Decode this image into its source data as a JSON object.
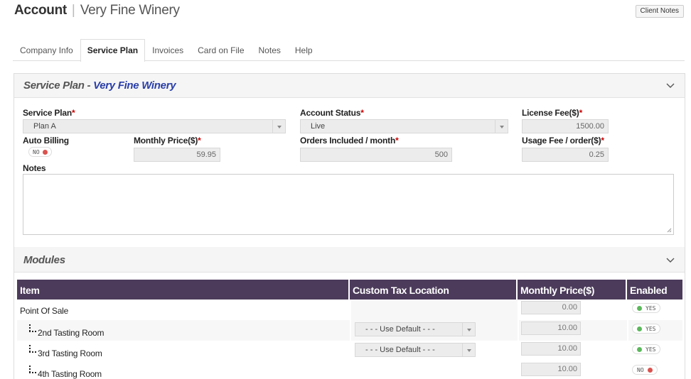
{
  "header": {
    "title": "Account",
    "subtitle": "Very Fine Winery",
    "client_notes_label": "Client Notes"
  },
  "tabs": [
    {
      "label": "Company Info"
    },
    {
      "label": "Service Plan"
    },
    {
      "label": "Invoices"
    },
    {
      "label": "Card on File"
    },
    {
      "label": "Notes"
    },
    {
      "label": "Help"
    }
  ],
  "service_plan_panel": {
    "title_prefix": "Service Plan - ",
    "title_company": "Very Fine Winery",
    "service_plan_label": "Service Plan",
    "service_plan_value": "Plan A",
    "account_status_label": "Account Status",
    "account_status_value": "Live",
    "license_fee_label": "License Fee($)",
    "license_fee_value": "1500.00",
    "auto_billing_label": "Auto Billing",
    "auto_billing_value": "NO",
    "monthly_price_label": "Monthly Price($)",
    "monthly_price_value": "59.95",
    "orders_included_label": "Orders Included / month",
    "orders_included_value": "500",
    "usage_fee_label": "Usage Fee / order($)",
    "usage_fee_value": "0.25",
    "notes_label": "Notes",
    "required_marker": "*"
  },
  "modules": {
    "title": "Modules",
    "columns": [
      "Item",
      "Custom Tax Location",
      "Monthly Price($)",
      "Enabled"
    ],
    "rows": [
      {
        "item": "Point Of Sale",
        "tax_location": "",
        "price": "0.00",
        "enabled": "YES"
      },
      {
        "item": "2nd Tasting Room",
        "tax_location": "- - - Use Default - - -",
        "price": "10.00",
        "enabled": "YES"
      },
      {
        "item": "3rd Tasting Room",
        "tax_location": "- - - Use Default - - -",
        "price": "10.00",
        "enabled": "YES"
      },
      {
        "item": "4th Tasting Room",
        "tax_location": "",
        "price": "10.00",
        "enabled": "NO"
      }
    ]
  },
  "colors": {
    "table_header": "#4c3b5b",
    "accent_title": "#2a3fa8",
    "required": "#cc0000",
    "toggle_off": "#d9534f",
    "toggle_on": "#5cb85c"
  }
}
